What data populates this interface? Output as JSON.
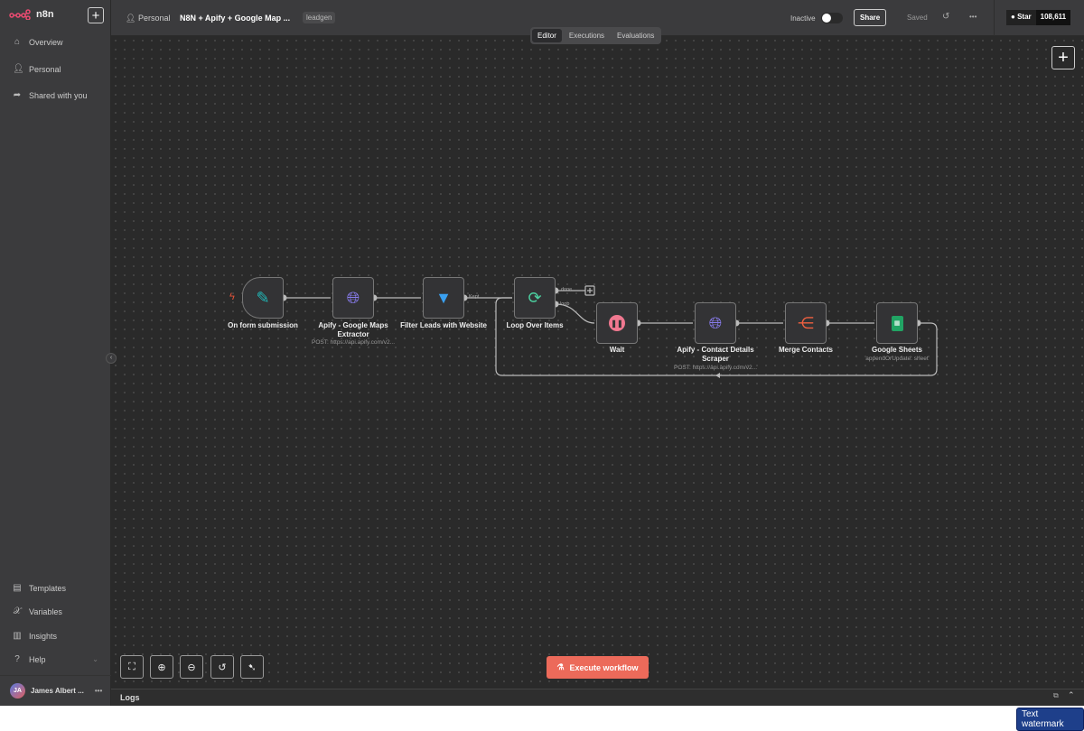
{
  "app": {
    "name": "n8n"
  },
  "sidebar": {
    "top_items": [
      {
        "label": "Overview",
        "icon": "home-icon"
      },
      {
        "label": "Personal",
        "icon": "user-icon"
      },
      {
        "label": "Shared with you",
        "icon": "share-icon"
      }
    ],
    "bottom_items": [
      {
        "label": "Templates",
        "icon": "box-icon"
      },
      {
        "label": "Variables",
        "icon": "variable-icon"
      },
      {
        "label": "Insights",
        "icon": "chart-icon"
      },
      {
        "label": "Help",
        "icon": "question-icon"
      }
    ],
    "user": {
      "initials": "JA",
      "name": "James Albert ..."
    }
  },
  "header": {
    "project": "Personal",
    "workflow_title": "N8N + Apify + Google Map ...",
    "tag": "leadgen",
    "status": "Inactive",
    "share": "Share",
    "saved": "Saved",
    "github_star": "Star",
    "github_count": "108,611"
  },
  "tabs": [
    "Editor",
    "Executions",
    "Evaluations"
  ],
  "nodes": [
    {
      "label": "On form submission",
      "sub": ""
    },
    {
      "label": "Apify - Google Maps Extractor",
      "sub": "POST: https://api.apify.com/v2..."
    },
    {
      "label": "Filter Leads with Website",
      "sub": ""
    },
    {
      "label": "Loop Over Items",
      "sub": ""
    },
    {
      "label": "Wait",
      "sub": ""
    },
    {
      "label": "Apify - Contact Details Scraper",
      "sub": "POST: https://api.apify.com/v2..."
    },
    {
      "label": "Merge Contacts",
      "sub": ""
    },
    {
      "label": "Google Sheets",
      "sub": "appendOrUpdate: sheet"
    }
  ],
  "edge_labels": {
    "kept": "Kept",
    "done": "done",
    "loop": "loop"
  },
  "execute": "Execute workflow",
  "logs": "Logs",
  "watermark": "Text watermark"
}
